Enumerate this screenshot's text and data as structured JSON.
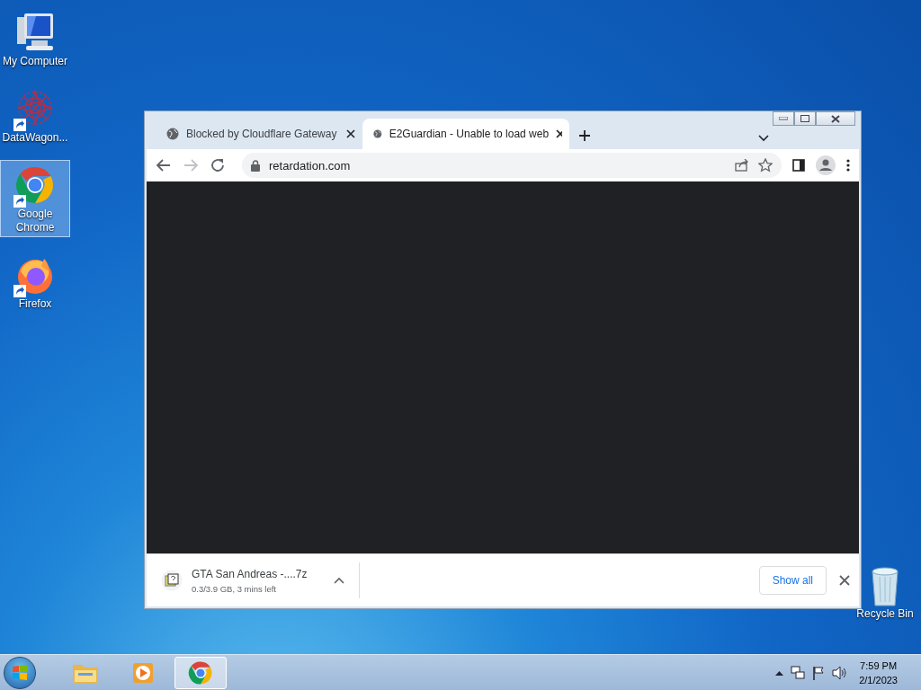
{
  "desktop_icons": [
    {
      "kind": "computer",
      "label": "My Computer",
      "selected": false
    },
    {
      "kind": "datawagon",
      "label": "DataWagon...",
      "selected": false
    },
    {
      "kind": "chrome",
      "label": "Google Chrome",
      "selected": true
    },
    {
      "kind": "firefox",
      "label": "Firefox",
      "selected": false
    }
  ],
  "recycle_bin": {
    "label": "Recycle Bin"
  },
  "browser": {
    "tabs": [
      {
        "title": "Blocked by Cloudflare Gateway",
        "selected": false
      },
      {
        "title": "E2Guardian - Unable to load web",
        "selected": true
      }
    ],
    "address": "retardation.com",
    "download": {
      "filename": "GTA San Andreas -....7z",
      "status": "0.3/3.9 GB, 3 mins left"
    },
    "show_all": "Show all"
  },
  "taskbar": {
    "apps": [
      {
        "kind": "explorer",
        "selected": false
      },
      {
        "kind": "media",
        "selected": false
      },
      {
        "kind": "chrome",
        "selected": true
      }
    ],
    "time": "7:59 PM",
    "date": "2/1/2023"
  }
}
